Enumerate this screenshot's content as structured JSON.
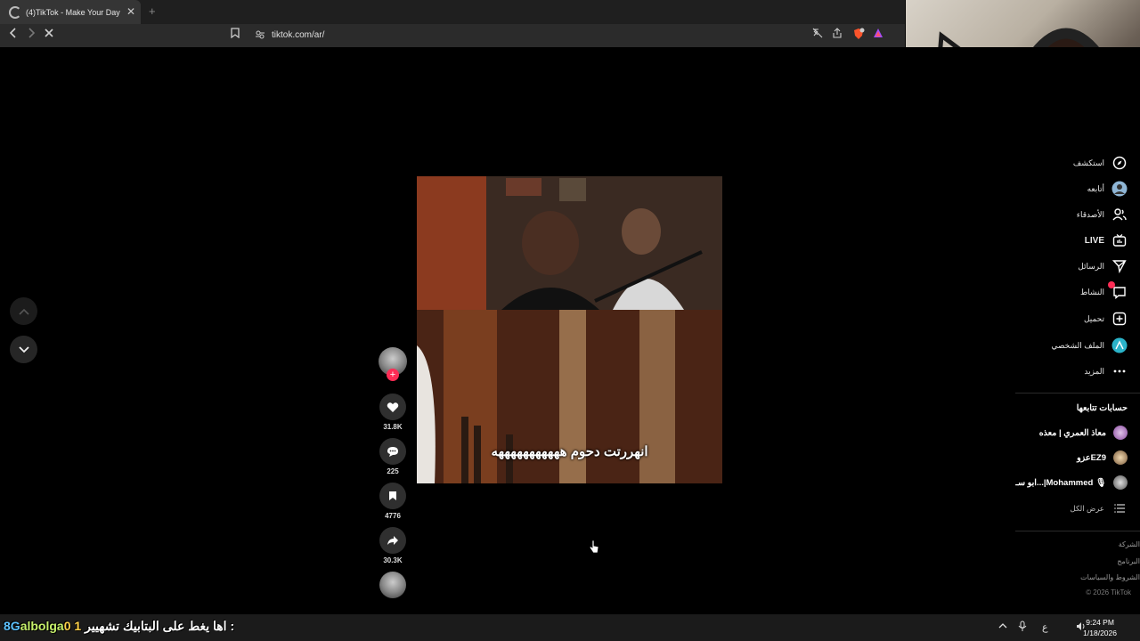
{
  "browser": {
    "tab_title": "(4)TikTok - Make Your Day",
    "url": "tiktok.com/ar/"
  },
  "video": {
    "subtitle": "انهررتت دحوم هههههههههههه"
  },
  "actions": {
    "likes": "31.8K",
    "comments": "225",
    "saves": "4776",
    "shares": "30.3K"
  },
  "sidebar": {
    "items": [
      {
        "label": "استكشف",
        "icon": "compass-icon"
      },
      {
        "label": "أتابعه",
        "icon": "following-avatar-icon"
      },
      {
        "label": "الأصدقاء",
        "icon": "friends-icon"
      },
      {
        "label": "LIVE",
        "icon": "live-tv-icon"
      },
      {
        "label": "الرسائل",
        "icon": "send-icon"
      },
      {
        "label": "النشاط",
        "icon": "activity-icon"
      },
      {
        "label": "تحميل",
        "icon": "upload-plus-icon"
      },
      {
        "label": "الملف الشخصي",
        "icon": "profile-avatar-icon"
      },
      {
        "label": "المزيد",
        "icon": "more-dots-icon"
      }
    ],
    "following_title": "حسابات تتابعها",
    "following": [
      {
        "name": "معاذ العمري | معذه"
      },
      {
        "name": "عزوEZ9"
      },
      {
        "name": "ابو سـ...|Mohammed 🎙"
      }
    ],
    "see_all": "عرض الكل",
    "footer": [
      "الشركة",
      "البرنامج",
      "الشروط والسياسات",
      "© 2026 TikTok"
    ]
  },
  "taskbar": {
    "overlay_prefix": "اها يغط على البتابيك تشهيير :",
    "overlay_name": "albolga",
    "overlay_digits": "0 1",
    "overlay_suffix": "8G",
    "lang": "ع",
    "time": "9:24 PM",
    "date": "1/18/2026"
  }
}
